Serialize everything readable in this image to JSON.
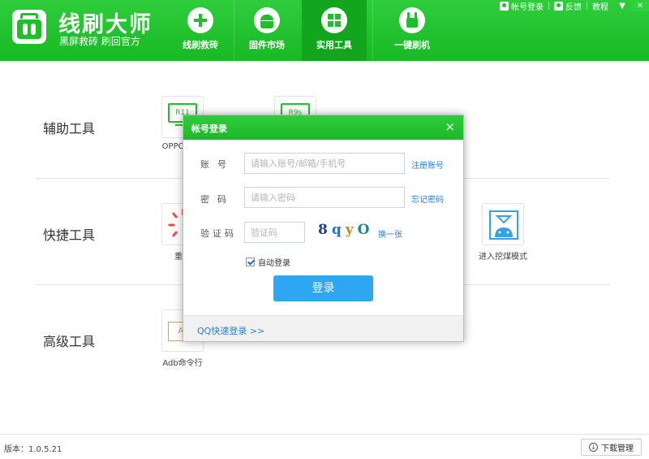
{
  "app": {
    "title": "线刷大师",
    "subtitle": "黑屏救砖 刷回官方"
  },
  "top_bar": {
    "login": "帐号登录",
    "feedback": "反馈",
    "tutorial": "教程",
    "menu_icon": "chevron-down-icon",
    "close_icon": "close-icon"
  },
  "nav": [
    {
      "label": "线刷救砖",
      "icon": "plus-icon",
      "active": false
    },
    {
      "label": "固件市场",
      "icon": "android-icon",
      "active": false
    },
    {
      "label": "实用工具",
      "icon": "grid-icon",
      "active": true
    },
    {
      "label": "一键刷机",
      "icon": "flash-icon",
      "active": false
    }
  ],
  "sections": [
    {
      "title": "辅助工具",
      "tools": [
        {
          "label": "OPPO R11",
          "icon": "phone-icon",
          "screen_text": "R11"
        },
        {
          "label": "",
          "icon": "phone-icon",
          "screen_text": "R9s"
        }
      ]
    },
    {
      "title": "快捷工具",
      "tools": [
        {
          "label": "重启",
          "icon": "reboot-icon"
        },
        {
          "label": "进入挖煤模式",
          "icon": "download-mode-icon"
        }
      ]
    },
    {
      "title": "高级工具",
      "tools": [
        {
          "label": "Adb命令行",
          "icon": "adb-icon",
          "box_text": "Ad"
        }
      ]
    }
  ],
  "footer": {
    "version": "版本：1.0.5.21",
    "download_manager": "下载管理"
  },
  "dialog": {
    "title": "帐号登录",
    "close": "×",
    "account_label": "账号",
    "account_placeholder": "请输入账号/邮箱/手机号",
    "account_value": "",
    "register": "注册账号",
    "password_label": "密码",
    "password_placeholder": "请输入密码",
    "password_value": "",
    "forgot": "忘记密码",
    "captcha_label": "验证码",
    "captcha_placeholder": "验证码",
    "captcha_value": "",
    "captcha_chars": [
      "8",
      "q",
      "y",
      "O"
    ],
    "captcha_colors": [
      "#1b3f8f",
      "#2b6fd1",
      "#c48a12",
      "#1d8a8a"
    ],
    "refresh": "换一张",
    "auto_login": "自动登录",
    "auto_login_checked": true,
    "login_button": "登录",
    "qq_login": "QQ快速登录 >>"
  },
  "colors": {
    "brand_green": "#1fbf2c",
    "button_blue": "#2ea6f2",
    "link_blue": "#2b7fd1"
  }
}
